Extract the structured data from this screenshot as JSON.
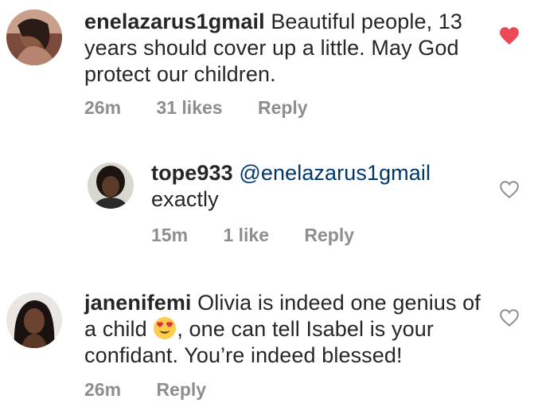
{
  "comments": [
    {
      "username": "enelazarus1gmail",
      "text": "Beautiful people, 13 years should cover up a little. May God protect our children.",
      "time": "26m",
      "likes": "31 likes",
      "reply_label": "Reply",
      "liked": true,
      "avatar_icon": "user-avatar-photo"
    },
    {
      "username": "tope933",
      "mention": "@enelazarus1gmail",
      "text": "exactly",
      "time": "15m",
      "likes": "1 like",
      "reply_label": "Reply",
      "liked": false,
      "avatar_icon": "user-avatar-photo"
    },
    {
      "username": "janenifemi",
      "text_part1": "Olivia is indeed one genius of a child",
      "emoji": "heart-eyes-emoji",
      "text_part2": ", one can tell Isabel is your confidant. You’re indeed blessed!",
      "time": "26m",
      "reply_label": "Reply",
      "liked": false,
      "avatar_icon": "user-avatar-photo"
    }
  ],
  "colors": {
    "text": "#262626",
    "meta": "#8e8e8e",
    "mention": "#00376b",
    "heart_liked": "#ed4956",
    "heart_outline": "#8e8e8e"
  }
}
